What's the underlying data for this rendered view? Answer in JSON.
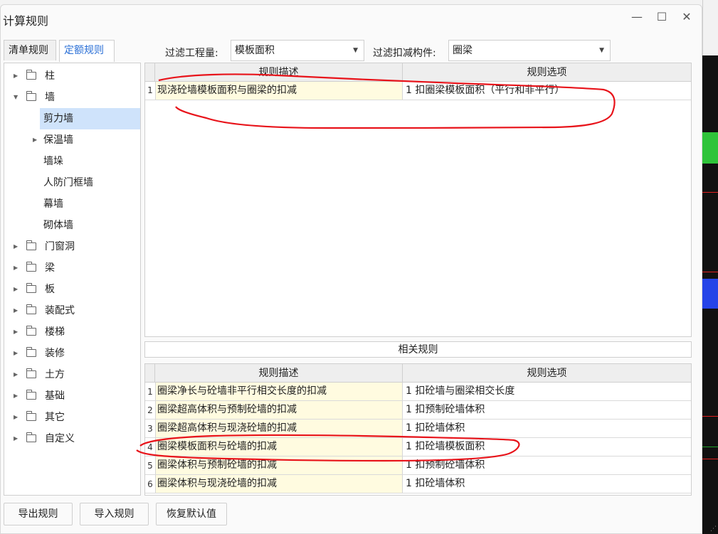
{
  "window": {
    "title": "计算规则",
    "minimize": "—",
    "maximize": "☐",
    "close": "✕"
  },
  "tabs": [
    {
      "label": "清单规则",
      "active": false
    },
    {
      "label": "定额规则",
      "active": true
    }
  ],
  "filters": {
    "quantity_label": "过滤工程量:",
    "quantity_value": "模板面积",
    "component_label": "过滤扣减构件:",
    "component_value": "圈梁"
  },
  "tree": [
    {
      "label": "柱",
      "type": "folder",
      "expanded": false
    },
    {
      "label": "墙",
      "type": "folder",
      "expanded": true
    },
    {
      "label": "剪力墙",
      "type": "child",
      "selected": true
    },
    {
      "label": "保温墙",
      "type": "child-expandable"
    },
    {
      "label": "墙垛",
      "type": "child"
    },
    {
      "label": "人防门框墙",
      "type": "child"
    },
    {
      "label": "幕墙",
      "type": "child"
    },
    {
      "label": "砌体墙",
      "type": "child"
    },
    {
      "label": "门窗洞",
      "type": "folder"
    },
    {
      "label": "梁",
      "type": "folder"
    },
    {
      "label": "板",
      "type": "folder"
    },
    {
      "label": "装配式",
      "type": "folder"
    },
    {
      "label": "楼梯",
      "type": "folder"
    },
    {
      "label": "装修",
      "type": "folder"
    },
    {
      "label": "土方",
      "type": "folder"
    },
    {
      "label": "基础",
      "type": "folder"
    },
    {
      "label": "其它",
      "type": "folder"
    },
    {
      "label": "自定义",
      "type": "folder"
    }
  ],
  "main_table": {
    "headers": [
      "规则描述",
      "规则选项"
    ],
    "rows": [
      {
        "num": "1",
        "desc": "现浇砼墙模板面积与圈梁的扣减",
        "option": "1  扣圈梁模板面积（平行和非平行）"
      }
    ]
  },
  "related": {
    "title": "相关规则",
    "headers": [
      "规则描述",
      "规则选项"
    ],
    "rows": [
      {
        "num": "1",
        "desc": "圈梁净长与砼墙非平行相交长度的扣减",
        "option": "1 扣砼墙与圈梁相交长度"
      },
      {
        "num": "2",
        "desc": "圈梁超高体积与预制砼墙的扣减",
        "option": "1 扣预制砼墙体积"
      },
      {
        "num": "3",
        "desc": "圈梁超高体积与现浇砼墙的扣减",
        "option": "1 扣砼墙体积"
      },
      {
        "num": "4",
        "desc": "圈梁模板面积与砼墙的扣减",
        "option": "1 扣砼墙模板面积"
      },
      {
        "num": "5",
        "desc": "圈梁体积与预制砼墙的扣减",
        "option": "1 扣预制砼墙体积"
      },
      {
        "num": "6",
        "desc": "圈梁体积与现浇砼墙的扣减",
        "option": "1 扣砼墙体积"
      }
    ]
  },
  "buttons": {
    "export": "导出规则",
    "import": "导入规则",
    "restore": "恢复默认值"
  },
  "annotation_color": "#e8131a"
}
